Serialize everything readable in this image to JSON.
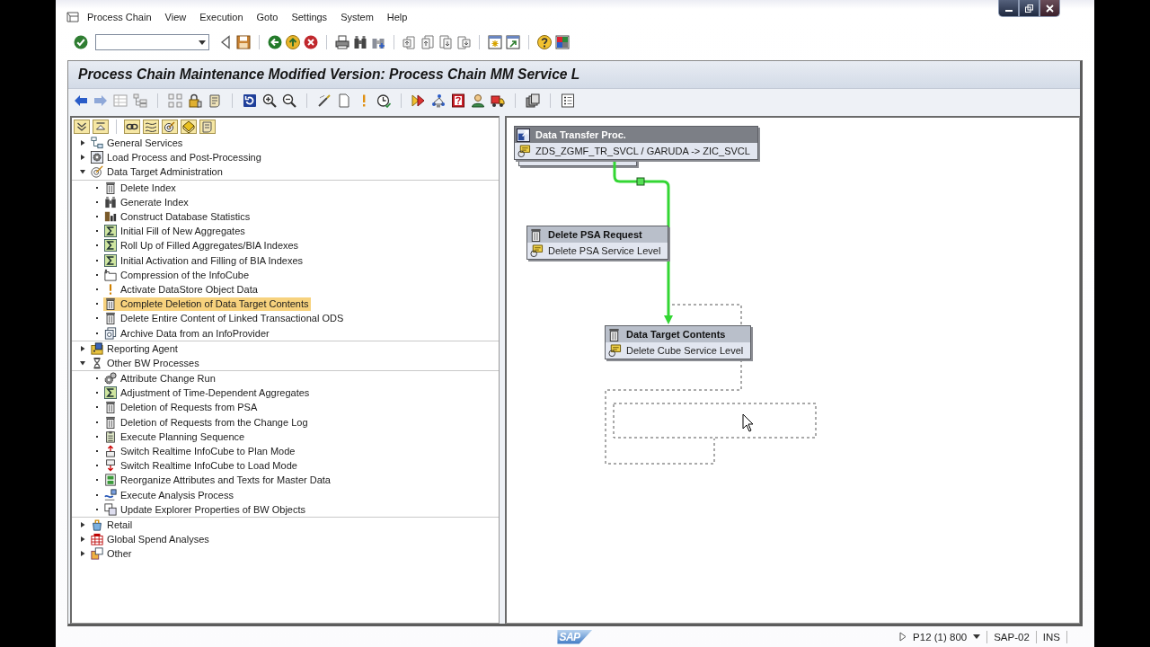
{
  "menu_bar": {
    "items": [
      "Process Chain",
      "View",
      "Execution",
      "Goto",
      "Settings",
      "System",
      "Help"
    ]
  },
  "title": "Process Chain Maintenance Modified Version: Process Chain MM Service L",
  "process_tree": {
    "groups": [
      {
        "label": "General Services",
        "expanded": false,
        "selected": false
      },
      {
        "label": "Load Process and Post-Processing",
        "expanded": false,
        "selected": false
      },
      {
        "label": "Data Target Administration",
        "expanded": true,
        "selected": false,
        "children": [
          {
            "label": "Delete Index",
            "selected": false
          },
          {
            "label": "Generate Index",
            "selected": false
          },
          {
            "label": "Construct Database Statistics",
            "selected": false
          },
          {
            "label": "Initial Fill of New Aggregates",
            "selected": false
          },
          {
            "label": "Roll Up of Filled Aggregates/BIA Indexes",
            "selected": false
          },
          {
            "label": "Initial Activation and Filling of BIA Indexes",
            "selected": false
          },
          {
            "label": "Compression of the InfoCube",
            "selected": false
          },
          {
            "label": "Activate DataStore Object Data",
            "selected": false
          },
          {
            "label": "Complete Deletion of Data Target Contents",
            "selected": true
          },
          {
            "label": "Delete Entire Content of Linked Transactional ODS",
            "selected": false
          },
          {
            "label": "Archive Data from an InfoProvider",
            "selected": false
          }
        ]
      },
      {
        "label": "Reporting Agent",
        "expanded": false,
        "selected": false
      },
      {
        "label": "Other BW Processes",
        "expanded": true,
        "selected": false,
        "children": [
          {
            "label": "Attribute Change Run",
            "selected": false
          },
          {
            "label": "Adjustment of Time-Dependent Aggregates",
            "selected": false
          },
          {
            "label": "Deletion of Requests from PSA",
            "selected": false
          },
          {
            "label": "Deletion of Requests from the Change Log",
            "selected": false
          },
          {
            "label": "Execute Planning Sequence",
            "selected": false
          },
          {
            "label": "Switch Realtime InfoCube to Plan Mode",
            "selected": false
          },
          {
            "label": "Switch Realtime InfoCube to Load Mode",
            "selected": false
          },
          {
            "label": "Reorganize Attributes and Texts for Master Data",
            "selected": false
          },
          {
            "label": "Execute Analysis Process",
            "selected": false
          },
          {
            "label": "Update Explorer Properties of BW Objects",
            "selected": false
          }
        ]
      },
      {
        "label": "Retail",
        "expanded": false,
        "selected": false
      },
      {
        "label": "Global Spend Analyses",
        "expanded": false,
        "selected": false
      },
      {
        "label": "Other",
        "expanded": false,
        "selected": false
      }
    ]
  },
  "chain_graph": {
    "nodes": [
      {
        "kind": "dtp",
        "title": "Data Transfer Proc.",
        "variant": "ZDS_ZGMF_TR_SVCL / GARUDA -> ZIC_SVCL",
        "selected": true
      },
      {
        "kind": "delete",
        "title": "Delete PSA Request",
        "variant": "Delete PSA Service Level",
        "selected": false
      },
      {
        "kind": "delete",
        "title": "Data Target Contents",
        "variant": "Delete Cube Service Level",
        "selected": false
      }
    ]
  },
  "status_bar": {
    "logo": "SAP",
    "system": "P12 (1) 800",
    "server": "SAP-02",
    "mode": "INS"
  }
}
